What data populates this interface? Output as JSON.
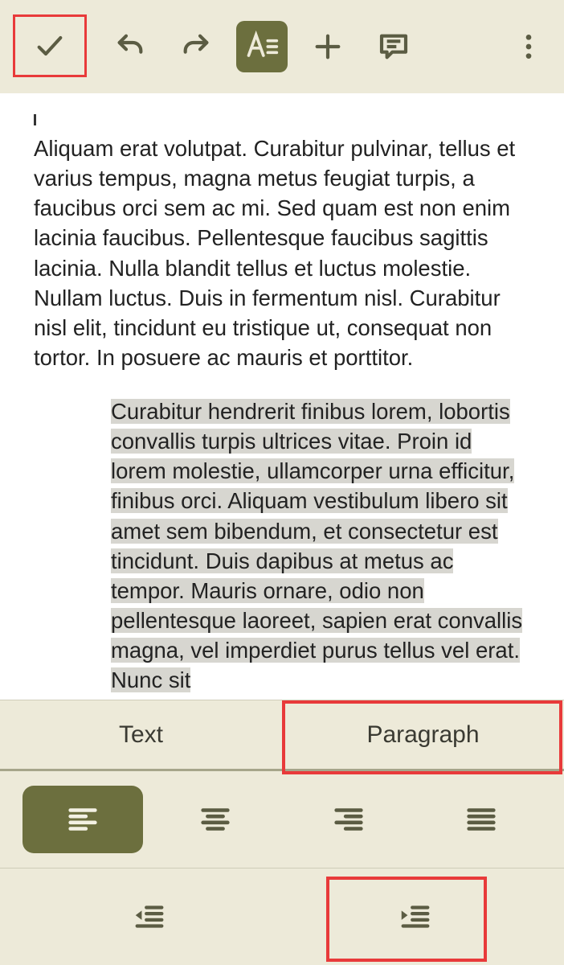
{
  "toolbar": {
    "confirm": "✓",
    "undo": "undo",
    "redo": "redo",
    "format": "A≡",
    "add": "+",
    "comment": "comment",
    "more": "⋮"
  },
  "content": {
    "paragraph1": "Aliquam erat volutpat. Curabitur pulvinar, tellus et varius tempus, magna metus feugiat turpis, a faucibus orci sem ac mi. Sed quam est non enim lacinia faucibus. Pellentesque faucibus sagittis lacinia. Nulla blandit tellus et luctus molestie. Nullam luctus. Duis in fermentum nisl. Curabitur nisl elit, tincidunt eu tristique ut, consequat non tortor. In posuere ac mauris et porttitor.",
    "paragraph2": "Curabitur hendrerit finibus lorem, lobortis convallis turpis ultrices vitae. Proin id lorem molestie, ullamcorper urna efficitur, finibus orci. Aliquam vestibulum libero sit amet sem bibendum, et consectetur est tincidunt. Duis dapibus at metus ac tempor. Mauris ornare, odio non pellentesque laoreet, sapien erat convallis magna, vel imperdiet purus tellus vel erat. Nunc sit"
  },
  "panel": {
    "tabs": {
      "text": "Text",
      "paragraph": "Paragraph"
    },
    "align": {
      "left": "align-left",
      "center": "align-center",
      "right": "align-right",
      "justify": "align-justify"
    },
    "indent": {
      "decrease": "indent-decrease",
      "increase": "indent-increase"
    }
  }
}
